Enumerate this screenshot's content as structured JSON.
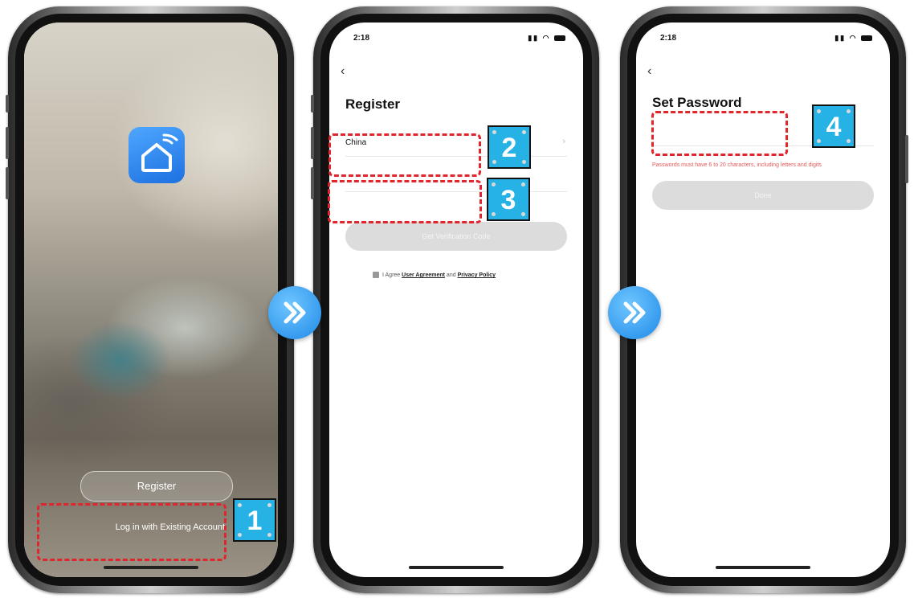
{
  "screen1": {
    "register_label": "Register",
    "login_label": "Log in with Existing Account"
  },
  "screen2": {
    "time": "2:18",
    "title": "Register",
    "country": "China",
    "verify_button": "Get Verification Code",
    "agree_prefix": "I Agree",
    "user_agreement": "User Agreement",
    "agree_and": "and",
    "privacy_policy": "Privacy Policy"
  },
  "screen3": {
    "time": "2:18",
    "title": "Set Password",
    "hint": "Passwords must have 6 to 20 characters, including letters and digits",
    "done_button": "Done"
  },
  "steps": [
    "1",
    "2",
    "3",
    "4"
  ],
  "colors": {
    "annotation_red": "#e0262c",
    "badge_blue": "#27b2e6",
    "arrow_blue": "#1f8ae8",
    "app_icon_blue": "#1e70e0",
    "hint_red": "#e05a5a",
    "disabled_gray": "#dcdcdc"
  },
  "icons": {
    "app": "smart-home-wifi-icon",
    "next": "double-chevron-right-icon",
    "back": "chevron-left-icon"
  }
}
